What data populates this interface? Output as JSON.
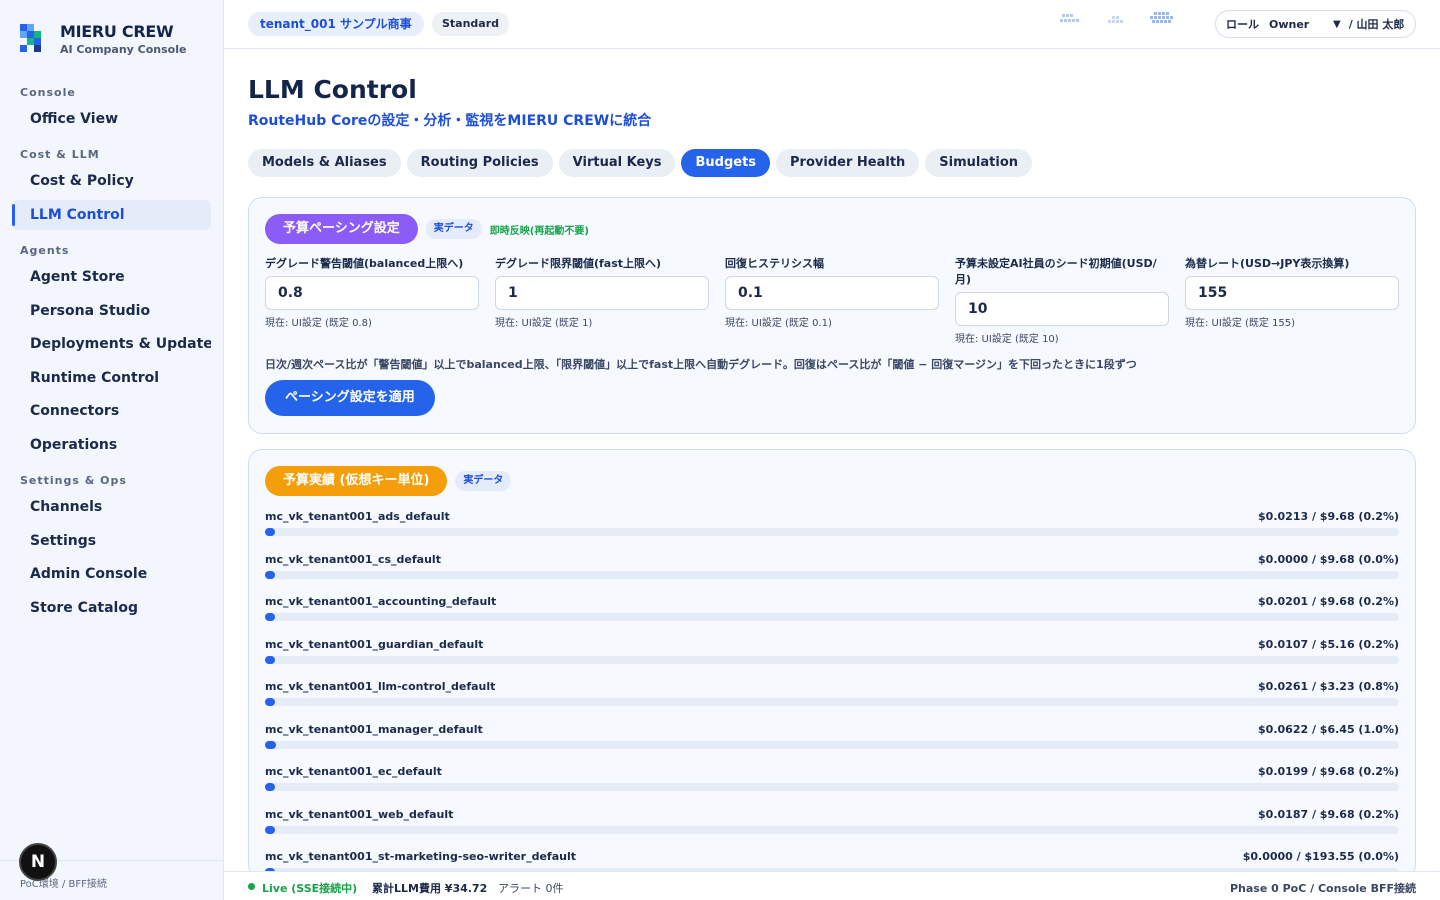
{
  "brand": {
    "title": "MIERU CREW",
    "subtitle": "AI Company Console"
  },
  "sidebar": {
    "sections": [
      {
        "label": "Console",
        "items": [
          "Office View"
        ]
      },
      {
        "label": "Cost & LLM",
        "items": [
          "Cost & Policy",
          "LLM Control"
        ]
      },
      {
        "label": "Agents",
        "items": [
          "Agent Store",
          "Persona Studio",
          "Deployments & Updates",
          "Runtime Control",
          "Connectors",
          "Operations"
        ]
      },
      {
        "label": "Settings & Ops",
        "items": [
          "Channels",
          "Settings",
          "Admin Console",
          "Store Catalog"
        ]
      }
    ],
    "active": "LLM Control",
    "footer": "PoC環境 / BFF接続",
    "badge": "N"
  },
  "topbar": {
    "tenant": "tenant_001 サンプル商事",
    "plan": "Standard",
    "role_label": "ロール",
    "role_value": "Owner",
    "user": "/ 山田 太郎"
  },
  "page": {
    "title": "LLM Control",
    "subtitle": "RouteHub Coreの設定・分析・監視をMIERU CREWに統合",
    "tabs": [
      "Models & Aliases",
      "Routing Policies",
      "Virtual Keys",
      "Budgets",
      "Provider Health",
      "Simulation"
    ],
    "active_tab": "Budgets"
  },
  "pacing": {
    "title": "予算ペーシング設定",
    "tag": "実データ",
    "note": "即時反映(再起動不要)",
    "fields": [
      {
        "label": "デグレード警告閾値(balanced上限へ)",
        "value": "0.8",
        "note": "現在: UI設定 (既定 0.8)"
      },
      {
        "label": "デグレード限界閾値(fast上限へ)",
        "value": "1",
        "note": "現在: UI設定 (既定 1)"
      },
      {
        "label": "回復ヒステリシス幅",
        "value": "0.1",
        "note": "現在: UI設定 (既定 0.1)"
      },
      {
        "label": "予算未設定AI社員のシード初期値(USD/月)",
        "value": "10",
        "note": "現在: UI設定 (既定 10)"
      },
      {
        "label": "為替レート(USD→JPY表示換算)",
        "value": "155",
        "note": "現在: UI設定 (既定 155)"
      }
    ],
    "description": "日次/週次ペース比が「警告閾値」以上でbalanced上限、「限界閾値」以上でfast上限へ自動デグレード。回復はペース比が「閾値 − 回復マージン」を下回ったときに1段ずつ",
    "apply_label": "ペーシング設定を適用"
  },
  "budgets": {
    "title": "予算実績 (仮想キー単位)",
    "tag": "実データ",
    "rows": [
      {
        "name": "mc_vk_tenant001_ads_default",
        "value": "$0.0213 / $9.68 (0.2%)",
        "percent": 0.2
      },
      {
        "name": "mc_vk_tenant001_cs_default",
        "value": "$0.0000 / $9.68 (0.0%)",
        "percent": 0.0
      },
      {
        "name": "mc_vk_tenant001_accounting_default",
        "value": "$0.0201 / $9.68 (0.2%)",
        "percent": 0.2
      },
      {
        "name": "mc_vk_tenant001_guardian_default",
        "value": "$0.0107 / $5.16 (0.2%)",
        "percent": 0.2
      },
      {
        "name": "mc_vk_tenant001_llm-control_default",
        "value": "$0.0261 / $3.23 (0.8%)",
        "percent": 0.8
      },
      {
        "name": "mc_vk_tenant001_manager_default",
        "value": "$0.0622 / $6.45 (1.0%)",
        "percent": 1.0
      },
      {
        "name": "mc_vk_tenant001_ec_default",
        "value": "$0.0199 / $9.68 (0.2%)",
        "percent": 0.2
      },
      {
        "name": "mc_vk_tenant001_web_default",
        "value": "$0.0187 / $9.68 (0.2%)",
        "percent": 0.2
      },
      {
        "name": "mc_vk_tenant001_st-marketing-seo-writer_default",
        "value": "$0.0000 / $193.55 (0.0%)",
        "percent": 0.0
      }
    ]
  },
  "status": {
    "live": "Live (SSE接続中)",
    "cost": "累計LLM費用 ¥34.72",
    "alerts": "アラート 0件",
    "phase": "Phase 0 PoC / Console BFF接続"
  },
  "colors": {
    "accent": "#2563eb",
    "purple": "#8b5cf6",
    "orange": "#f59e0b",
    "green": "#16a34a"
  }
}
